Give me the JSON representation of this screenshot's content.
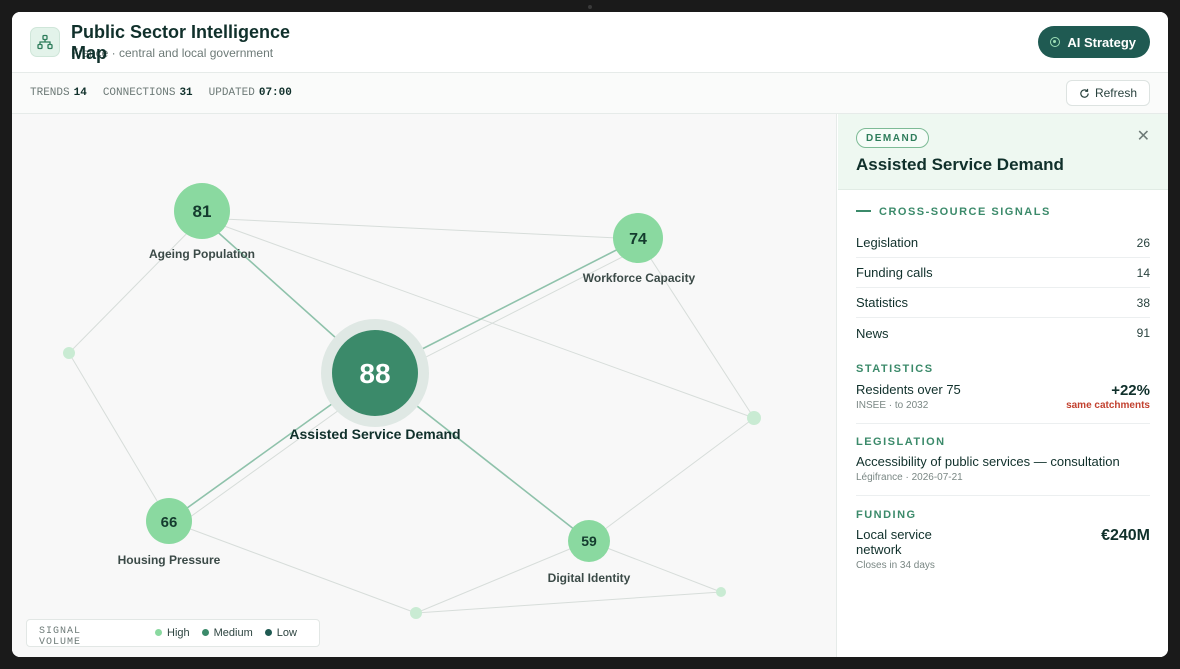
{
  "header": {
    "title": "Public Sector Intelligence Map",
    "subtitle": "France · central and local government",
    "ai_button": "AI Strategy"
  },
  "stats": {
    "trends_label": "TRENDS",
    "trends": "14",
    "connections_label": "CONNECTIONS",
    "connections": "31",
    "updated_label": "UPDATED",
    "updated": "07:00",
    "refresh": "Refresh"
  },
  "map": {
    "nodes": [
      {
        "id": "assisted",
        "score": "88",
        "label": "Assisted Service Demand",
        "level": "Medium"
      },
      {
        "id": "ageing",
        "score": "81",
        "label": "Ageing Population",
        "level": "High"
      },
      {
        "id": "workforce",
        "score": "74",
        "label": "Workforce Capacity",
        "level": "High"
      },
      {
        "id": "housing",
        "score": "66",
        "label": "Housing Pressure",
        "level": "High"
      },
      {
        "id": "digital",
        "score": "59",
        "label": "Digital Identity",
        "level": "High"
      }
    ],
    "legend": {
      "title": "SIGNAL VOLUME",
      "items": [
        "High",
        "Medium",
        "Low"
      ],
      "colors": [
        "#8ad9a0",
        "#3b8a6a",
        "#1f5a52"
      ]
    }
  },
  "panel": {
    "badge": "DEMAND",
    "title": "Assisted Service Demand",
    "signals_label": "CROSS-SOURCE SIGNALS",
    "signals": [
      {
        "label": "Legislation",
        "value": "26"
      },
      {
        "label": "Funding calls",
        "value": "14"
      },
      {
        "label": "Statistics",
        "value": "38"
      },
      {
        "label": "News",
        "value": "91"
      }
    ],
    "statistics": {
      "label": "STATISTICS",
      "main": "Residents over 75",
      "sub": "INSEE · to 2032",
      "value": "+22%",
      "note": "same catchments"
    },
    "legislation": {
      "label": "LEGISLATION",
      "main": "Accessibility of public services — consultation",
      "sub": "Légifrance · 2026-07-21"
    },
    "funding": {
      "label": "FUNDING",
      "main": "Local service network",
      "sub": "Closes in 34 days",
      "value": "€240M"
    }
  },
  "colors": {
    "accent": "#1f5a52",
    "node_high": "#8ad9a0",
    "node_center": "#3b8a6a",
    "warning": "#c2412f"
  }
}
